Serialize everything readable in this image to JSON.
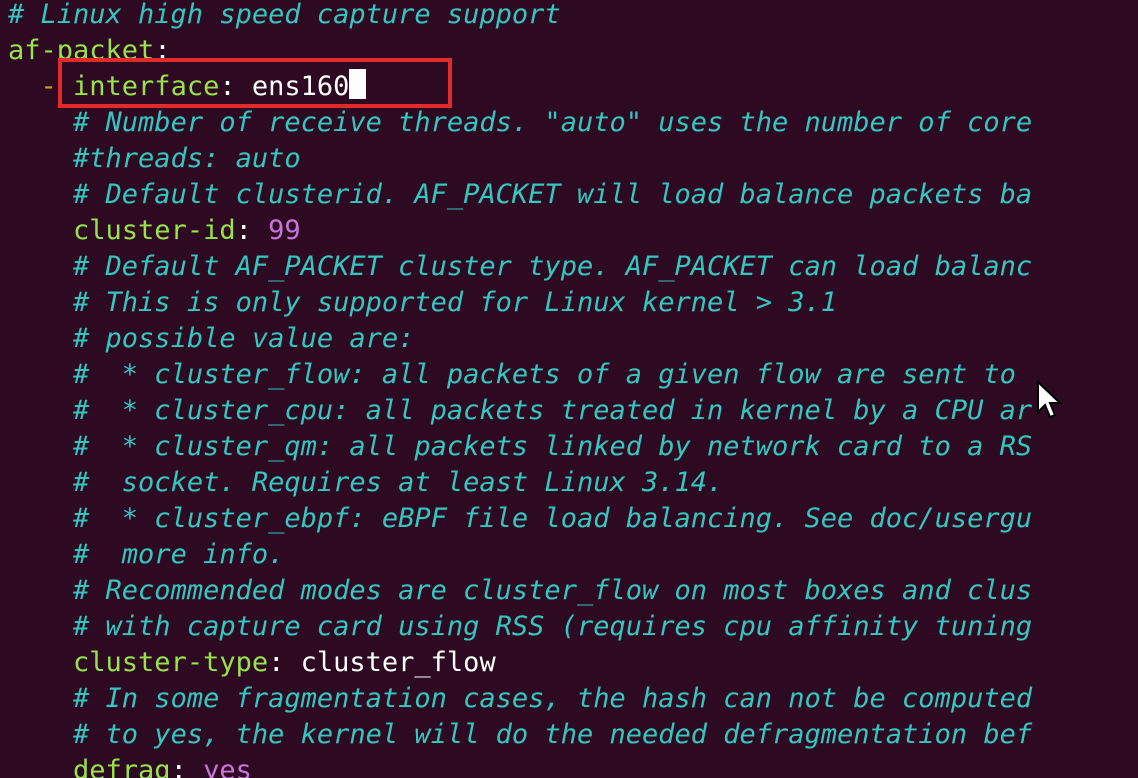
{
  "editor": {
    "lines": [
      {
        "indent": "",
        "comment": "# Linux high speed capture support"
      },
      {
        "indent": "",
        "key": "af-packet",
        "colon": ":"
      },
      {
        "indent": "  ",
        "dash": "- ",
        "key": "interface",
        "colon": ":",
        "value": " ens160",
        "cursor": true
      },
      {
        "indent": "    ",
        "comment": "# Number of receive threads. \"auto\" uses the number of core"
      },
      {
        "indent": "    ",
        "comment": "#threads: auto"
      },
      {
        "indent": "    ",
        "comment": "# Default clusterid. AF_PACKET will load balance packets ba"
      },
      {
        "indent": "    ",
        "key": "cluster-id",
        "colon": ":",
        "num": " 99"
      },
      {
        "indent": "    ",
        "comment": "# Default AF_PACKET cluster type. AF_PACKET can load balanc"
      },
      {
        "indent": "    ",
        "comment": "# This is only supported for Linux kernel > 3.1"
      },
      {
        "indent": "    ",
        "comment": "# possible value are:"
      },
      {
        "indent": "    ",
        "comment": "#  * cluster_flow: all packets of a given flow are sent to "
      },
      {
        "indent": "    ",
        "comment": "#  * cluster_cpu: all packets treated in kernel by a CPU ar"
      },
      {
        "indent": "    ",
        "comment": "#  * cluster_qm: all packets linked by network card to a RS"
      },
      {
        "indent": "    ",
        "comment": "#  socket. Requires at least Linux 3.14."
      },
      {
        "indent": "    ",
        "comment": "#  * cluster_ebpf: eBPF file load balancing. See doc/usergu"
      },
      {
        "indent": "    ",
        "comment": "#  more info."
      },
      {
        "indent": "    ",
        "comment": "# Recommended modes are cluster_flow on most boxes and clus"
      },
      {
        "indent": "    ",
        "comment": "# with capture card using RSS (requires cpu affinity tuning"
      },
      {
        "indent": "    ",
        "key": "cluster-type",
        "colon": ":",
        "value": " cluster_flow"
      },
      {
        "indent": "    ",
        "comment": "# In some fragmentation cases, the hash can not be computed"
      },
      {
        "indent": "    ",
        "comment": "# to yes, the kernel will do the needed defragmentation bef"
      },
      {
        "indent": "    ",
        "key": "defrag",
        "colon": ":",
        "num": " yes"
      }
    ]
  },
  "colors": {
    "background": "#2d0a22",
    "comment": "#34c7c0",
    "key": "#98e34b",
    "number": "#c874d8",
    "highlight_box": "#e32a2a"
  },
  "icons": {
    "pointer": "mouse-pointer-icon"
  }
}
